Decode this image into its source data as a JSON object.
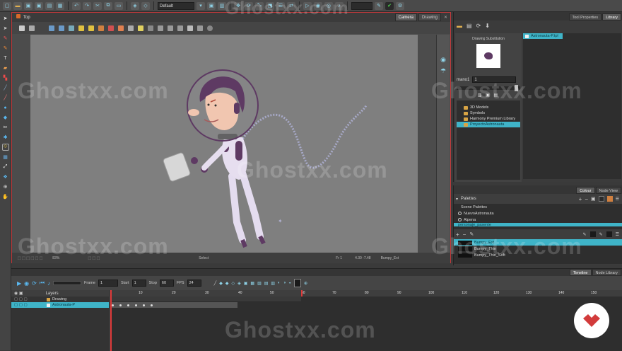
{
  "toolbar": {
    "preset_select": "Default"
  },
  "camera_view": {
    "title": "Top",
    "tabs": [
      "Camera",
      "Drawing"
    ],
    "status": {
      "zoom": "83%",
      "mode": "Select",
      "frame": "Fr 1",
      "coords": "4.30 -7.48",
      "palette": "Bumpy_Ext"
    }
  },
  "library": {
    "tabs": [
      "Tool Properties",
      "Library"
    ],
    "subview_title": "Drawing Substitution",
    "name_label": "mano1",
    "name_value": "1",
    "tree": [
      {
        "label": "3D Models",
        "selected": false
      },
      {
        "label": "Symbols",
        "selected": false
      },
      {
        "label": "Harmony Premium Library",
        "selected": false
      },
      {
        "label": "ProyectoAstronauta",
        "selected": true
      }
    ],
    "file_item": "Astronauta-P.tpl"
  },
  "colour": {
    "tabs": [
      "Colour",
      "Node View"
    ],
    "palettes_header": "Palettes",
    "scene_palettes_label": "Scene Palettes",
    "palettes": [
      {
        "name": "NuevoAstronauta",
        "selected": false
      },
      {
        "name": "Alpena",
        "selected": false
      },
      {
        "name": "personaje_pasente",
        "selected": true
      }
    ],
    "swatches": [
      {
        "name": "Bumpy_Ext",
        "selected": true
      },
      {
        "name": "Bumpy_Thin",
        "selected": false
      },
      {
        "name": "Bumpy_Thin_Soft",
        "selected": false
      }
    ]
  },
  "timeline": {
    "tabs": [
      "Timeline",
      "Node Library"
    ],
    "frame_label": "Frame",
    "frame_value": "1",
    "start_label": "Start",
    "start_value": "1",
    "stop_label": "Stop",
    "stop_value": "60",
    "fps_label": "FPS",
    "fps_value": "24",
    "layers_header": "Layers",
    "layers": [
      {
        "name": "Drawing",
        "selected": false
      },
      {
        "name": "Astronauta-P",
        "selected": true
      }
    ],
    "ruler": [
      "10",
      "20",
      "30",
      "40",
      "50",
      "60",
      "70",
      "80",
      "90",
      "100",
      "110",
      "120",
      "130",
      "140",
      "150"
    ]
  },
  "watermark_text": "Ghostxx.com",
  "colors": {
    "accent": "#3fb4c8",
    "view_border": "#c0393b",
    "canvas_bg": "#7f7f7f",
    "astronaut_purple": "#5e3a63"
  }
}
